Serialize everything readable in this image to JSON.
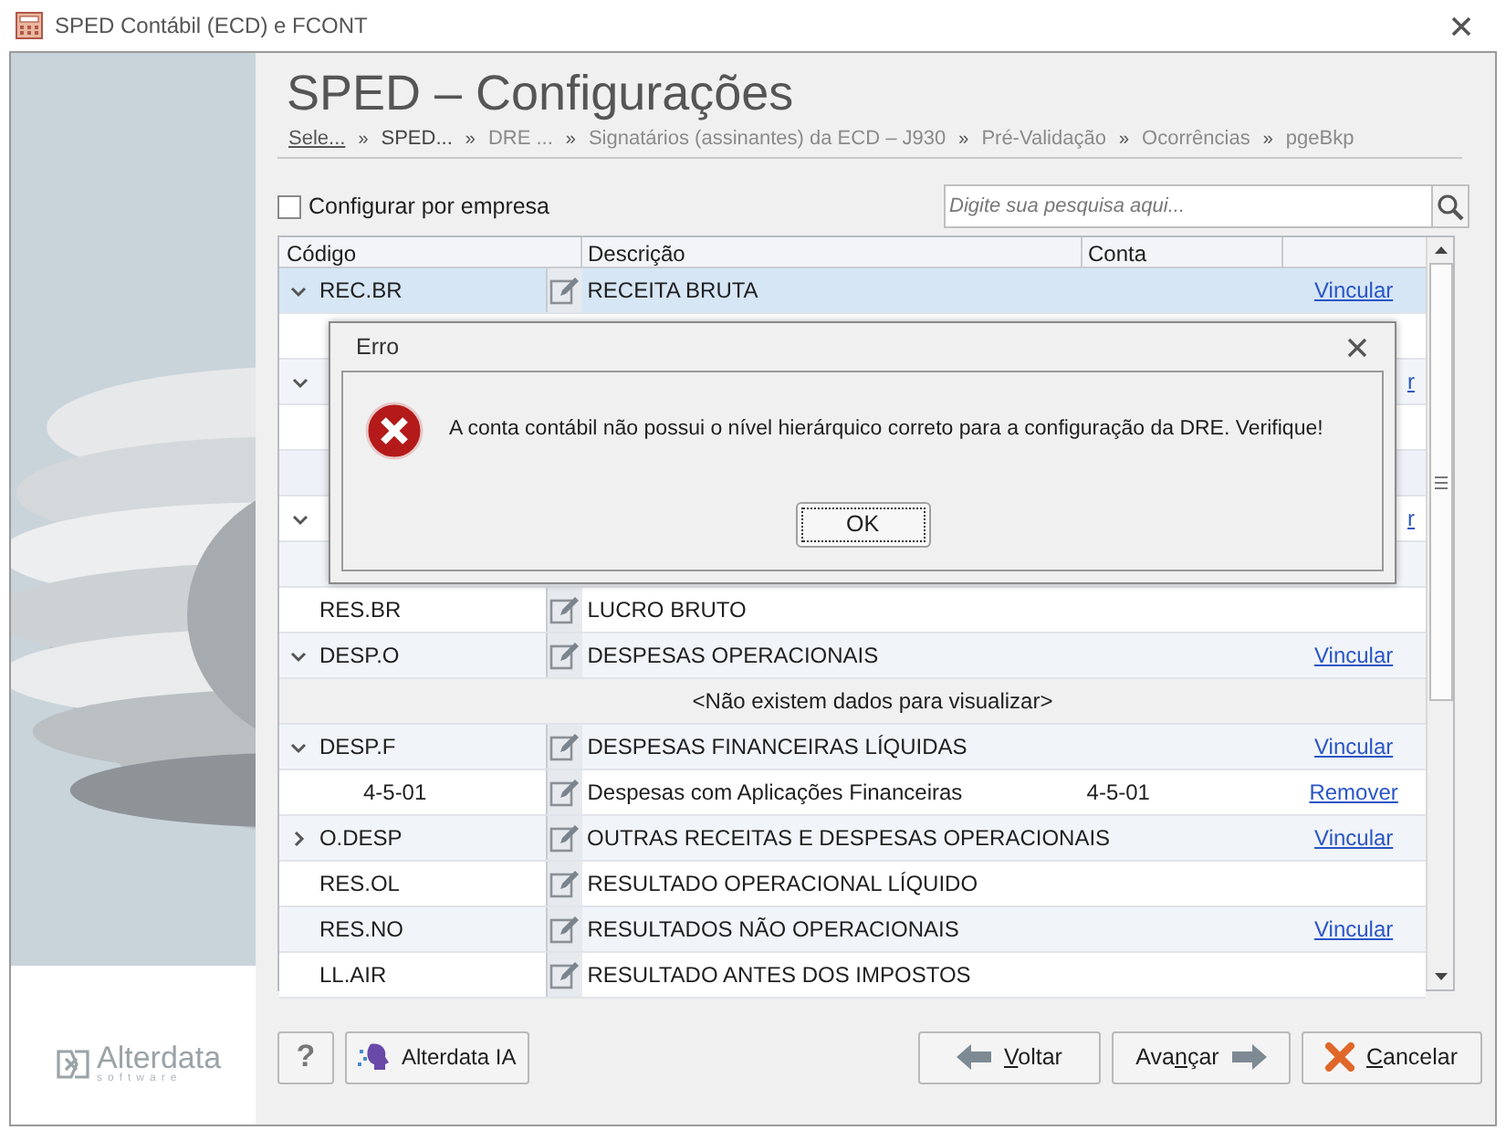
{
  "window": {
    "title": "SPED Contábil (ECD) e FCONT"
  },
  "header": {
    "title": "SPED – Configurações",
    "breadcrumb": [
      {
        "label": "Sele...",
        "kind": "link"
      },
      {
        "label": "SPED...",
        "kind": "current"
      },
      {
        "label": "DRE ...",
        "kind": "pending"
      },
      {
        "label": "Signatários (assinantes) da ECD – J930",
        "kind": "pending"
      },
      {
        "label": "Pré-Validação",
        "kind": "pending"
      },
      {
        "label": "Ocorrências",
        "kind": "pending"
      },
      {
        "label": "pgeBkp",
        "kind": "pending"
      }
    ],
    "separator": "»"
  },
  "options": {
    "configure_per_company": {
      "label": "Configurar por empresa",
      "checked": false
    }
  },
  "search": {
    "placeholder": "Digite sua pesquisa aqui..."
  },
  "table": {
    "columns": [
      "Código",
      "Descrição",
      "Conta"
    ],
    "rows": [
      {
        "kind": "group",
        "code": "REC.BR",
        "description": "RECEITA BRUTA",
        "expanded": true,
        "link": "Vincular",
        "selected": true
      },
      {
        "kind": "covered"
      },
      {
        "kind": "covered",
        "expanded": true,
        "link": "r"
      },
      {
        "kind": "covered"
      },
      {
        "kind": "covered_band"
      },
      {
        "kind": "covered",
        "expanded": true,
        "link": "r"
      },
      {
        "kind": "covered"
      },
      {
        "kind": "group",
        "code": "RES.BR",
        "description": "LUCRO BRUTO",
        "selected": false
      },
      {
        "kind": "group",
        "code": "DESP.O",
        "description": "DESPESAS OPERACIONAIS",
        "expanded": true,
        "link": "Vincular",
        "selected": false
      },
      {
        "kind": "empty",
        "message": "<Não existem dados para visualizar>"
      },
      {
        "kind": "group",
        "code": "DESP.F",
        "description": "DESPESAS FINANCEIRAS LÍQUIDAS",
        "expanded": true,
        "link": "Vincular",
        "selected": false
      },
      {
        "kind": "child",
        "code": "4-5-01",
        "description": "Despesas com Aplicações Financeiras",
        "account": "4-5-01",
        "link": "Remover",
        "selected": false
      },
      {
        "kind": "group",
        "code": "O.DESP",
        "description": "OUTRAS RECEITAS E DESPESAS OPERACIONAIS",
        "expanded": false,
        "link": "Vincular",
        "selected": false
      },
      {
        "kind": "group",
        "code": "RES.OL",
        "description": "RESULTADO OPERACIONAL LÍQUIDO",
        "selected": false
      },
      {
        "kind": "group",
        "code": "RES.NO",
        "description": "RESULTADOS NÃO OPERACIONAIS",
        "link": "Vincular",
        "selected": false
      },
      {
        "kind": "group",
        "code": "LL.AIR",
        "description": "RESULTADO ANTES DOS IMPOSTOS",
        "selected": false
      }
    ]
  },
  "dialog": {
    "title": "Erro",
    "message": "A conta contábil não possui o nível hierárquico correto para a configuração da DRE. Verifique!",
    "button": "OK"
  },
  "logo": {
    "name": "Alterdata",
    "tagline": "software"
  },
  "footer": {
    "help": "?",
    "ai_button": "Alterdata IA",
    "buttons": [
      {
        "kind": "back",
        "key": "V",
        "post": "oltar"
      },
      {
        "kind": "next",
        "pre": "Ava",
        "key": "n",
        "post": "çar"
      },
      {
        "kind": "cancel",
        "key": "C",
        "post": "ancelar"
      }
    ]
  }
}
